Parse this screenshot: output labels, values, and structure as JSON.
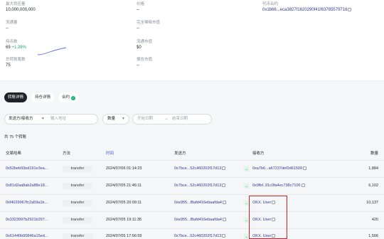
{
  "overview": {
    "max_supply_label": "最大供应量",
    "max_supply_value": "10,000,000,000",
    "circulating_label": "流通量",
    "circulating_value": "--",
    "holders_label": "持币数",
    "holders_value": "69",
    "holders_change": "+1.39%",
    "transfers_label": "总转账笔数",
    "transfers_value": "75",
    "price_label": "价格",
    "price_value": "--",
    "fdv_label": "完全稀释市值",
    "fdv_value": "--",
    "circ_mcap_label": "流通市值",
    "circ_mcap_value": "$0",
    "pre_mcap_label": "报告市值",
    "pre_mcap_value": "--",
    "contract_label": "代币合约",
    "contract_value": "0x1b66...eca3827f1620290f41f63785579716"
  },
  "tabs": [
    {
      "label": "转账详情"
    },
    {
      "label": "持仓详情"
    },
    {
      "label": "合约"
    }
  ],
  "filters": {
    "direction": "发送方/接收方",
    "address_placeholder": "输入地址",
    "amount": "数量",
    "start_placeholder": "开始日期",
    "end_placeholder": "结束日期"
  },
  "summary": "共 75 个转账",
  "table": {
    "headers": {
      "hash": "交易哈希",
      "method": "方法",
      "time": "时间",
      "from": "发送方",
      "to": "接收方",
      "amount": "数量"
    },
    "rows": [
      {
        "hash": "0x52beb93ed191e3ea...",
        "method": "transfer",
        "time": "2024/07/06 01:14:23",
        "from": "0x7bce...52c460202f17d13",
        "to": "0xa7b6...a67237def2d61509",
        "amount": "1,884"
      },
      {
        "hash": "0x81d2aa8ab2a88e18...",
        "method": "transfer",
        "time": "2024/07/05 21:46:11",
        "from": "0x7bce...52c460202f17d13",
        "to": "0x9fbf..91c0fa4ec738c7105",
        "amount": "6,102"
      },
      {
        "hash": "0xf4029967fc2a59a1b...",
        "method": "transfer",
        "time": "2024/07/05 20:09:11",
        "from": "0xe955...f8afd416ebaafda4",
        "to": "OKX. User",
        "amount": "10,137"
      },
      {
        "hash": "0x3323997b2921b297...",
        "method": "transfer",
        "time": "2024/07/05 19:11:35",
        "from": "0xe955...f8afd416ebaafda4",
        "to": "OKX. User",
        "amount": "420"
      },
      {
        "hash": "0x61440b90846a15ed...",
        "method": "transfer",
        "time": "2024/07/05 17:56:59",
        "from": "0x7bce...52c460202f17d13",
        "to": "OKX. User",
        "amount": "1,506"
      }
    ]
  },
  "colors": {
    "link": "#2f3a8f",
    "positive": "#22a86b",
    "highlight_box": "#d21f2a"
  }
}
